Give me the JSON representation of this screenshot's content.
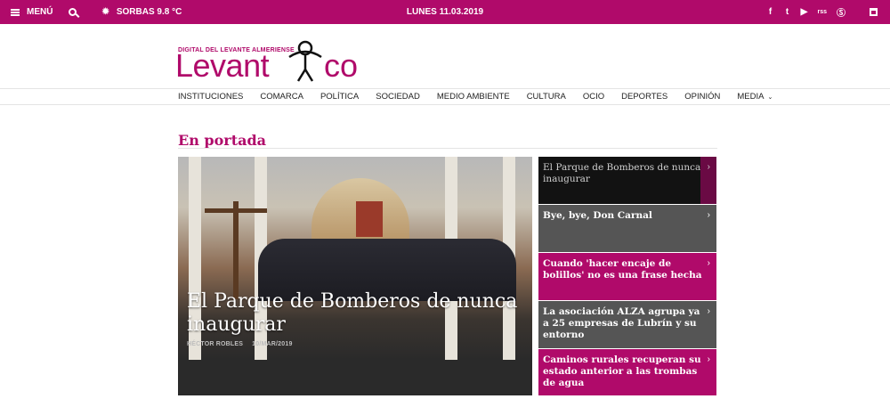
{
  "topbar": {
    "menu_label": "MENÚ",
    "weather": "SORBAS  9.8 °C",
    "date": "LUNES 11.03.2019",
    "social": [
      "f",
      "t",
      "▶",
      "rss",
      "Ⓢ"
    ],
    "calendar_icon": "calendar-icon"
  },
  "logo": {
    "tagline": "DIGITAL DEL LEVANTE ALMERIENSE",
    "word_start": "Levant",
    "word_end": "co",
    "color": "#b00a6a"
  },
  "nav": {
    "items": [
      "INSTITUCIONES",
      "COMARCA",
      "POLÍTICA",
      "SOCIEDAD",
      "MEDIO AMBIENTE",
      "CULTURA",
      "OCIO",
      "DEPORTES",
      "OPINIÓN",
      "MEDIA"
    ]
  },
  "section": {
    "title": "En portada"
  },
  "featured": {
    "headline": "El Parque de Bomberos de nunca inaugurar",
    "author": "HÉCTOR ROBLES",
    "date": "10/MAR/2019"
  },
  "side_items": [
    {
      "title": "El Parque de Bomberos de nunca inaugurar",
      "bg": "#121212",
      "active": true
    },
    {
      "title": "Bye, bye, Don Carnal",
      "bg": "#555555",
      "active": false
    },
    {
      "title": "Cuando 'hacer encaje de bolillos' no es una frase hecha",
      "bg": "#b00a6a",
      "active": false
    },
    {
      "title": "La asociación ALZA agrupa ya a 25 empresas de Lubrín y su entorno",
      "bg": "#555555",
      "active": false
    },
    {
      "title": "Caminos rurales recuperan su estado anterior a las trombas de agua",
      "bg": "#b00a6a",
      "active": false
    }
  ],
  "colors": {
    "brand": "#b00a6a",
    "dark": "#121212",
    "grey": "#555555"
  }
}
